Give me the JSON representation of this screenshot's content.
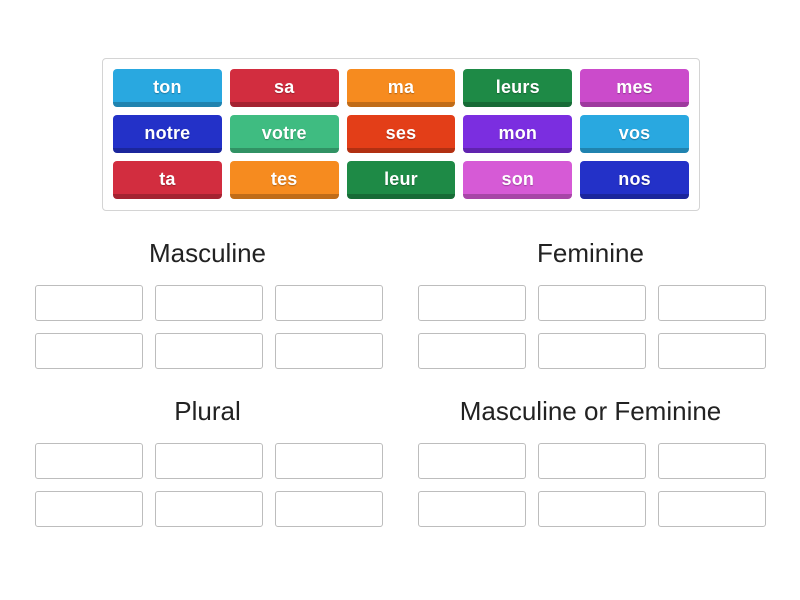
{
  "activity": {
    "type": "group-sort",
    "word_bank": {
      "rows": [
        [
          {
            "label": "ton",
            "color": "#29a8e0"
          },
          {
            "label": "sa",
            "color": "#d22d3f"
          },
          {
            "label": "ma",
            "color": "#f68b1f"
          },
          {
            "label": "leurs",
            "color": "#1e8a46"
          },
          {
            "label": "mes",
            "color": "#cb4bcb"
          }
        ],
        [
          {
            "label": "notre",
            "color": "#2331c8"
          },
          {
            "label": "votre",
            "color": "#3fbc81"
          },
          {
            "label": "ses",
            "color": "#e33e18"
          },
          {
            "label": "mon",
            "color": "#7b2ee0"
          },
          {
            "label": "vos",
            "color": "#29a8e0"
          }
        ],
        [
          {
            "label": "ta",
            "color": "#d22d3f"
          },
          {
            "label": "tes",
            "color": "#f68b1f"
          },
          {
            "label": "leur",
            "color": "#1e8a46"
          },
          {
            "label": "son",
            "color": "#d munge"
          },
          {
            "label": "nos",
            "color": "#2331c8"
          }
        ]
      ]
    },
    "categories": [
      {
        "title": "Masculine",
        "slot_count": 6,
        "slots": [
          "",
          "",
          "",
          "",
          "",
          ""
        ]
      },
      {
        "title": "Feminine",
        "slot_count": 6,
        "slots": [
          "",
          "",
          "",
          "",
          "",
          ""
        ]
      },
      {
        "title": "Plural",
        "slot_count": 6,
        "slots": [
          "",
          "",
          "",
          "",
          "",
          ""
        ]
      },
      {
        "title": "Masculine or Feminine",
        "slot_count": 6,
        "slots": [
          "",
          "",
          "",
          "",
          "",
          ""
        ]
      }
    ]
  }
}
